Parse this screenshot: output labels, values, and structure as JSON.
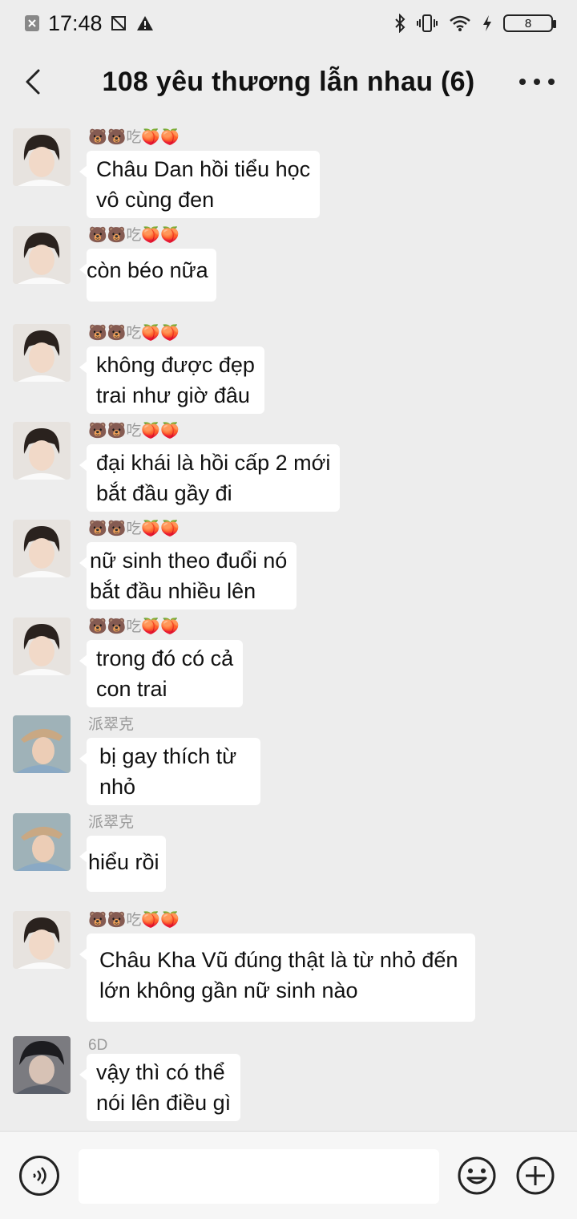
{
  "status": {
    "time": "17:48",
    "battery": "8"
  },
  "header": {
    "title": "108 yêu thương lẫn nhau (6)"
  },
  "messages": [
    {
      "sender": "🐻🐻吃🍑🍑",
      "avatar": "boy-a",
      "text": "Châu Dan hồi tiểu học\nvô cùng đen"
    },
    {
      "sender": "🐻🐻吃🍑🍑",
      "avatar": "boy-a",
      "text": "còn béo nữa"
    },
    {
      "sender": "🐻🐻吃🍑🍑",
      "avatar": "boy-a",
      "text": "không được đẹp\ntrai như giờ đâu"
    },
    {
      "sender": "🐻🐻吃🍑🍑",
      "avatar": "boy-a",
      "text": "đại khái là hồi cấp 2 mới\nbắt đầu gầy đi"
    },
    {
      "sender": "🐻🐻吃🍑🍑",
      "avatar": "boy-a",
      "text": "nữ sinh theo đuổi nó\nbắt đầu nhiều lên"
    },
    {
      "sender": "🐻🐻吃🍑🍑",
      "avatar": "boy-a",
      "text": "trong đó có cả\ncon trai"
    },
    {
      "sender": "派翠克",
      "avatar": "boy-b",
      "text": "bị gay thích từ\nnhỏ"
    },
    {
      "sender": "派翠克",
      "avatar": "boy-b",
      "text": "hiểu rồi"
    },
    {
      "sender": "🐻🐻吃🍑🍑",
      "avatar": "boy-a",
      "text": "Châu Kha Vũ đúng thật là từ nhỏ đến\nlớn không gần nữ sinh nào"
    },
    {
      "sender": "6D",
      "avatar": "boy-c",
      "text": "vậy thì có thể\nnói lên điều gì"
    }
  ],
  "input": {
    "placeholder": ""
  },
  "colors": {
    "background": "#ededed",
    "bubble": "#ffffff",
    "sender": "#9a9a9a"
  },
  "icons": [
    "back-arrow-icon",
    "more-icon",
    "voice-icon",
    "emoji-icon",
    "plus-icon"
  ]
}
